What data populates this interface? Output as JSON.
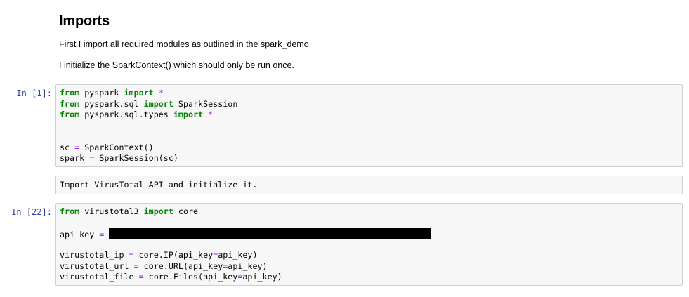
{
  "markdown": {
    "heading": "Imports",
    "para1": "First I import all required modules as outlined in the spark_demo.",
    "para2": "I initialize the SparkContext() which should only be run once."
  },
  "cell1": {
    "prompt": "In [1]:",
    "lines": [
      [
        {
          "t": "from",
          "c": "kw"
        },
        {
          "t": " pyspark ",
          "c": ""
        },
        {
          "t": "import",
          "c": "kw"
        },
        {
          "t": " ",
          "c": ""
        },
        {
          "t": "*",
          "c": "op"
        }
      ],
      [
        {
          "t": "from",
          "c": "kw"
        },
        {
          "t": " pyspark.sql ",
          "c": ""
        },
        {
          "t": "import",
          "c": "kw"
        },
        {
          "t": " SparkSession",
          "c": ""
        }
      ],
      [
        {
          "t": "from",
          "c": "kw"
        },
        {
          "t": " pyspark.sql.types ",
          "c": ""
        },
        {
          "t": "import",
          "c": "kw"
        },
        {
          "t": " ",
          "c": ""
        },
        {
          "t": "*",
          "c": "op"
        }
      ],
      [],
      [],
      [
        {
          "t": "sc ",
          "c": ""
        },
        {
          "t": "=",
          "c": "op"
        },
        {
          "t": " SparkContext()",
          "c": ""
        }
      ],
      [
        {
          "t": "spark ",
          "c": ""
        },
        {
          "t": "=",
          "c": "op"
        },
        {
          "t": " SparkSession(sc)",
          "c": ""
        }
      ]
    ]
  },
  "raw_cell": {
    "text": "Import VirusTotal API and initialize it."
  },
  "cell2": {
    "prompt": "In [22]:",
    "lines": [
      [
        {
          "t": "from",
          "c": "kw"
        },
        {
          "t": " virustotal3 ",
          "c": ""
        },
        {
          "t": "import",
          "c": "kw"
        },
        {
          "t": " core",
          "c": ""
        }
      ],
      [],
      [
        {
          "t": "api_key ",
          "c": ""
        },
        {
          "t": "=",
          "c": "op"
        },
        {
          "t": " ",
          "c": ""
        },
        {
          "t": "",
          "c": "redact"
        }
      ],
      [],
      [
        {
          "t": "virustotal_ip ",
          "c": ""
        },
        {
          "t": "=",
          "c": "op"
        },
        {
          "t": " core.IP(api_key",
          "c": ""
        },
        {
          "t": "=",
          "c": "op"
        },
        {
          "t": "api_key)",
          "c": ""
        }
      ],
      [
        {
          "t": "virustotal_url ",
          "c": ""
        },
        {
          "t": "=",
          "c": "op"
        },
        {
          "t": " core.URL(api_key",
          "c": ""
        },
        {
          "t": "=",
          "c": "op"
        },
        {
          "t": "api_key)",
          "c": ""
        }
      ],
      [
        {
          "t": "virustotal_file ",
          "c": ""
        },
        {
          "t": "=",
          "c": "op"
        },
        {
          "t": " core.Files(api_key",
          "c": ""
        },
        {
          "t": "=",
          "c": "op"
        },
        {
          "t": "api_key)",
          "c": ""
        }
      ]
    ]
  }
}
